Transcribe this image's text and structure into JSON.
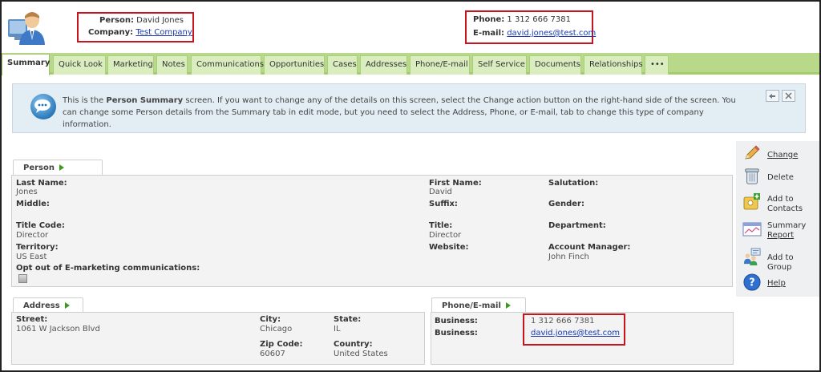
{
  "header": {
    "person_label": "Person:",
    "person_value": "David Jones",
    "company_label": "Company:",
    "company_value": "Test Company",
    "phone_label": "Phone:",
    "phone_value": "1 312 666 7381",
    "email_label": "E-mail:",
    "email_value": "david.jones@test.com",
    "avatar_icon": "person-icon"
  },
  "tabs": [
    {
      "label": "Summary",
      "active": true
    },
    {
      "label": "Quick Look"
    },
    {
      "label": "Marketing"
    },
    {
      "label": "Notes"
    },
    {
      "label": "Communications"
    },
    {
      "label": "Opportunities"
    },
    {
      "label": "Cases"
    },
    {
      "label": "Addresses"
    },
    {
      "label": "Phone/E-mail"
    },
    {
      "label": "Self Service"
    },
    {
      "label": "Documents"
    },
    {
      "label": "Relationships"
    },
    {
      "label": "•••"
    }
  ],
  "info": {
    "pre": "This is the ",
    "bold": "Person Summary",
    "post": " screen. If you want to change any of the details on this screen, select the Change action button on the right-hand side of the screen. You can change some Person details from the Summary tab in edit mode, but you need to select the Address, Phone, or E-mail, tab to change this type of company information.",
    "icon": "speech-bubble-icon"
  },
  "person": {
    "title": "Person",
    "last_name_label": "Last Name:",
    "last_name": "Jones",
    "middle_label": "Middle:",
    "title_code_label": "Title Code:",
    "title_code": "Director",
    "territory_label": "Territory:",
    "territory": "US East",
    "opt_out_label": "Opt out of E-marketing communications:",
    "first_name_label": "First Name:",
    "first_name": "David",
    "suffix_label": "Suffix:",
    "title_label": "Title:",
    "title_value": "Director",
    "website_label": "Website:",
    "salutation_label": "Salutation:",
    "gender_label": "Gender:",
    "department_label": "Department:",
    "account_manager_label": "Account Manager:",
    "account_manager": "John Finch"
  },
  "address": {
    "title": "Address",
    "street_label": "Street:",
    "street": "1061 W Jackson Blvd",
    "city_label": "City:",
    "city": "Chicago",
    "state_label": "State:",
    "state": "IL",
    "zip_label": "Zip Code:",
    "zip": "60607",
    "country_label": "Country:",
    "country": "United States"
  },
  "phone_email": {
    "title": "Phone/E-mail",
    "business_phone_label": "Business:",
    "business_phone": "1 312 666 7381",
    "business_email_label": "Business:",
    "business_email": "david.jones@test.com"
  },
  "actions": [
    {
      "label": "Change",
      "icon": "pencil-icon"
    },
    {
      "label": "Delete",
      "icon": "trash-icon"
    },
    {
      "label": "Add to Contacts",
      "line1": "Add to",
      "line2": "Contacts",
      "icon": "contact-card-icon"
    },
    {
      "label": "Summary Report",
      "line1": "Summary",
      "line2": "Report",
      "icon": "report-icon"
    },
    {
      "label": "Add to Group",
      "icon": "group-icon"
    },
    {
      "label": "Help",
      "icon": "help-icon"
    }
  ],
  "colors": {
    "tab_bar": "#b8d98a",
    "highlight_box": "#c8141e",
    "link": "#1a3ab0",
    "info_bg": "#e3edf4"
  }
}
